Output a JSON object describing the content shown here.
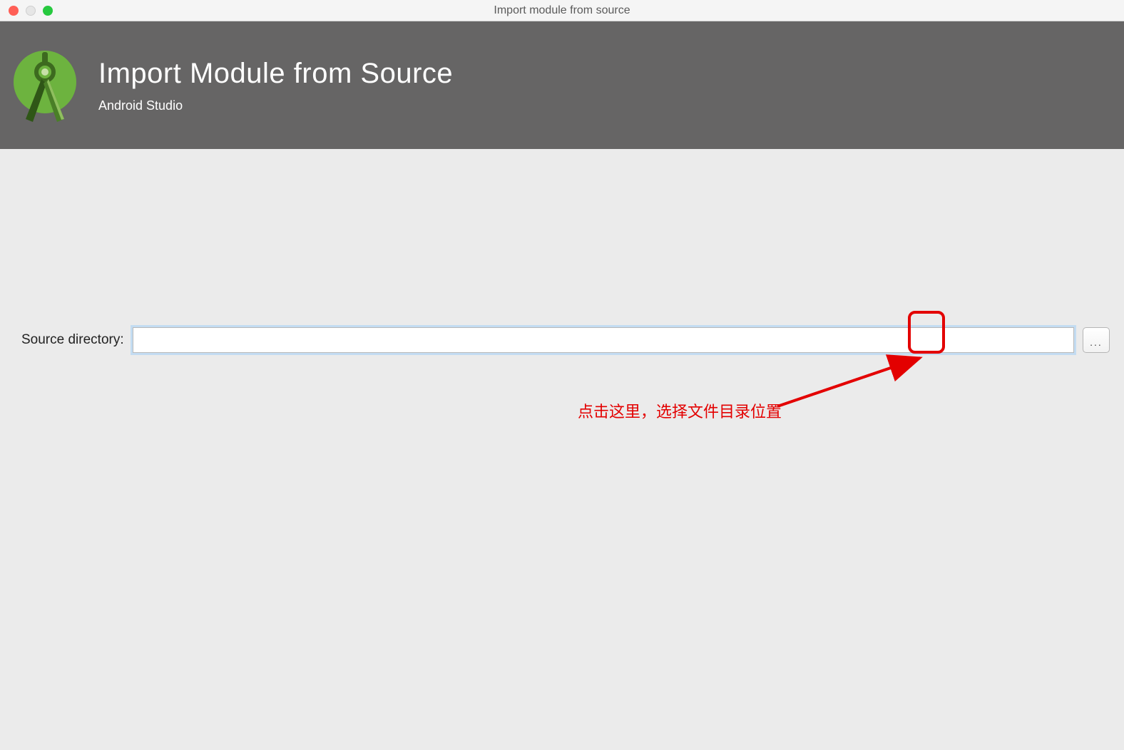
{
  "window": {
    "title": "Import module from source"
  },
  "header": {
    "title": "Import Module from Source",
    "subtitle": "Android Studio"
  },
  "form": {
    "source_directory_label": "Source directory:",
    "source_directory_value": "",
    "browse_button_label": "..."
  },
  "annotation": {
    "text": "点击这里，选择文件目录位置"
  }
}
